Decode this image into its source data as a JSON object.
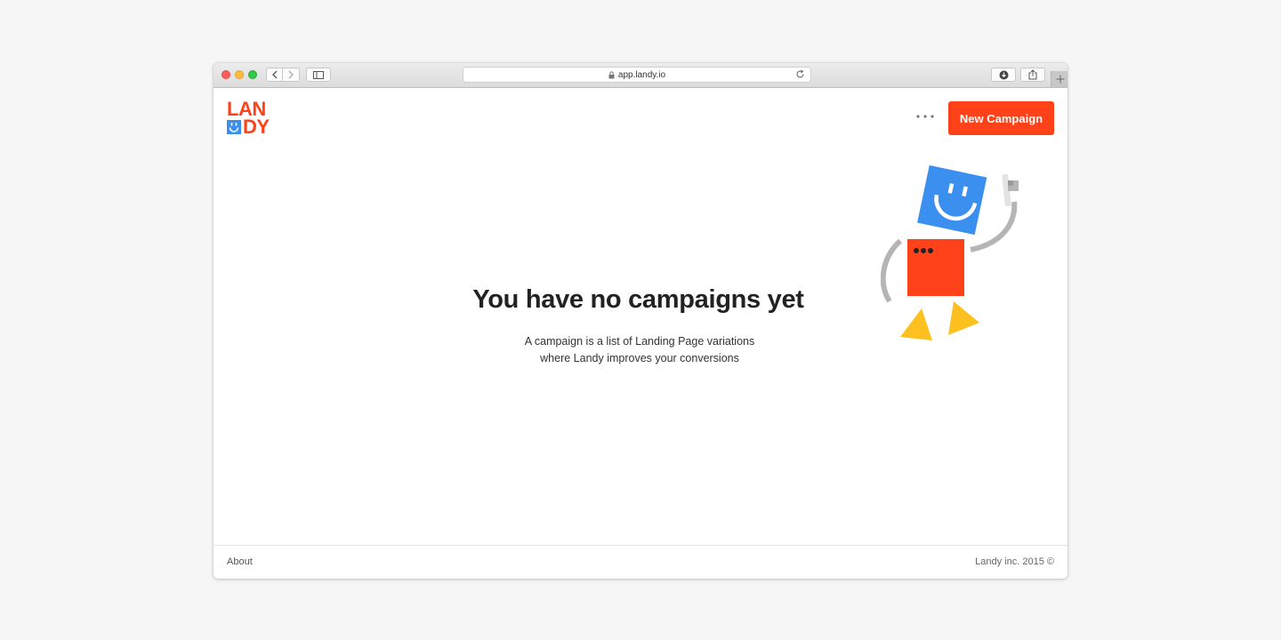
{
  "browser": {
    "url": "app.landy.io",
    "icons": [
      "lock-icon",
      "reload-icon",
      "back-icon",
      "forward-icon",
      "sidebar-icon",
      "download-icon",
      "share-icon",
      "plus-icon"
    ]
  },
  "header": {
    "logo_top": "LAN",
    "logo_bottom": "DY",
    "new_campaign_label": "New Campaign"
  },
  "main": {
    "title": "You have no campaigns yet",
    "description_line1": "A campaign is a list of Landing Page variations",
    "description_line2": "where Landy improves your conversions"
  },
  "footer": {
    "about_label": "About",
    "copyright": "Landy inc. 2015 ©"
  },
  "colors": {
    "accent": "#ff4219",
    "blue": "#3b8fef",
    "yellow": "#fcc11f",
    "gray": "#b5b5b5"
  }
}
